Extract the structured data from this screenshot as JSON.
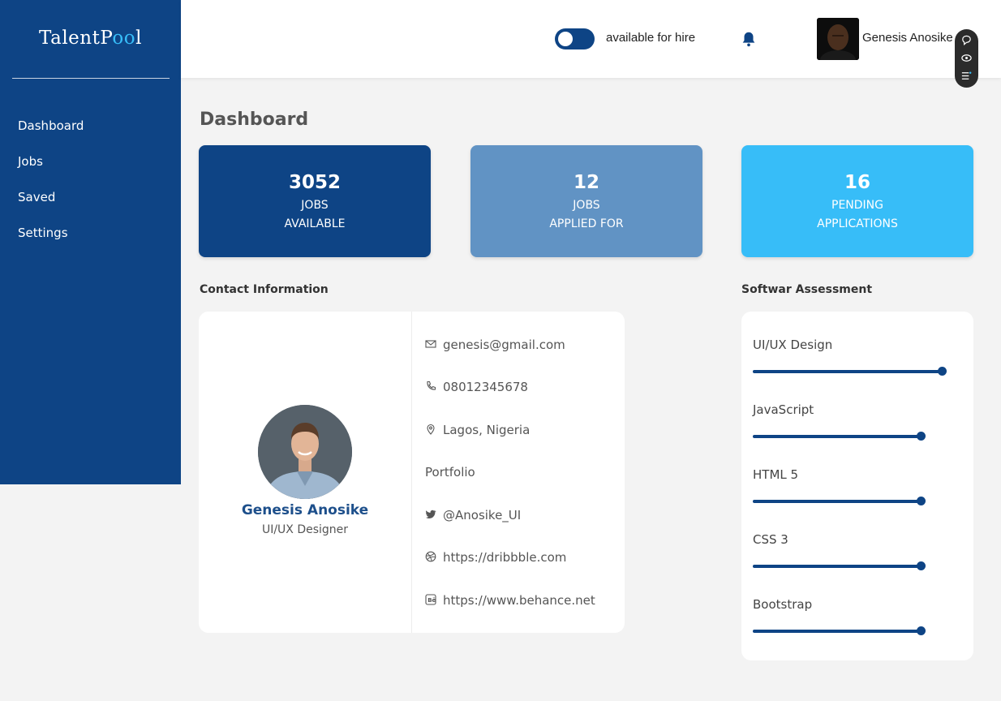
{
  "sidebar": {
    "logo_main": "TalentP",
    "logo_accent": "oo",
    "logo_end": "l",
    "nav": [
      "Dashboard",
      "Jobs",
      "Saved",
      "Settings"
    ]
  },
  "header": {
    "hire_label": "available for hire",
    "hire_toggle_on": true,
    "user_name": "Genesis Anosike"
  },
  "main": {
    "title": "Dashboard",
    "stats": [
      {
        "value": "3052",
        "line1": "JOBS",
        "line2": "AVAILABLE",
        "color": "#0e4485"
      },
      {
        "value": "12",
        "line1": "JOBS",
        "line2": "APPLIED FOR",
        "color": "#6193c4"
      },
      {
        "value": "16",
        "line1": "PENDING",
        "line2": "APPLICATIONS",
        "color": "#37bdf8"
      }
    ],
    "contact_title": "Contact Information",
    "skills_title": "Softwar Assessment"
  },
  "profile": {
    "name": "Genesis Anosike",
    "role": "UI/UX Designer"
  },
  "contact": {
    "email": "genesis@gmail.com",
    "phone": "08012345678",
    "location": "Lagos, Nigeria",
    "portfolio_label": "Portfolio",
    "twitter": "@Anosike_UI",
    "dribbble": "https://dribbble.com",
    "behance": "https://www.behance.net"
  },
  "skills": [
    {
      "name": "UI/UX Design",
      "level": 0.99
    },
    {
      "name": "JavaScript",
      "level": 0.88
    },
    {
      "name": "HTML 5",
      "level": 0.88
    },
    {
      "name": "CSS 3",
      "level": 0.88
    },
    {
      "name": "Bootstrap",
      "level": 0.88
    }
  ],
  "colors": {
    "primary": "#0e4485",
    "secondary": "#6193c4",
    "accent": "#37bdf8",
    "background": "#f3f3f3"
  }
}
